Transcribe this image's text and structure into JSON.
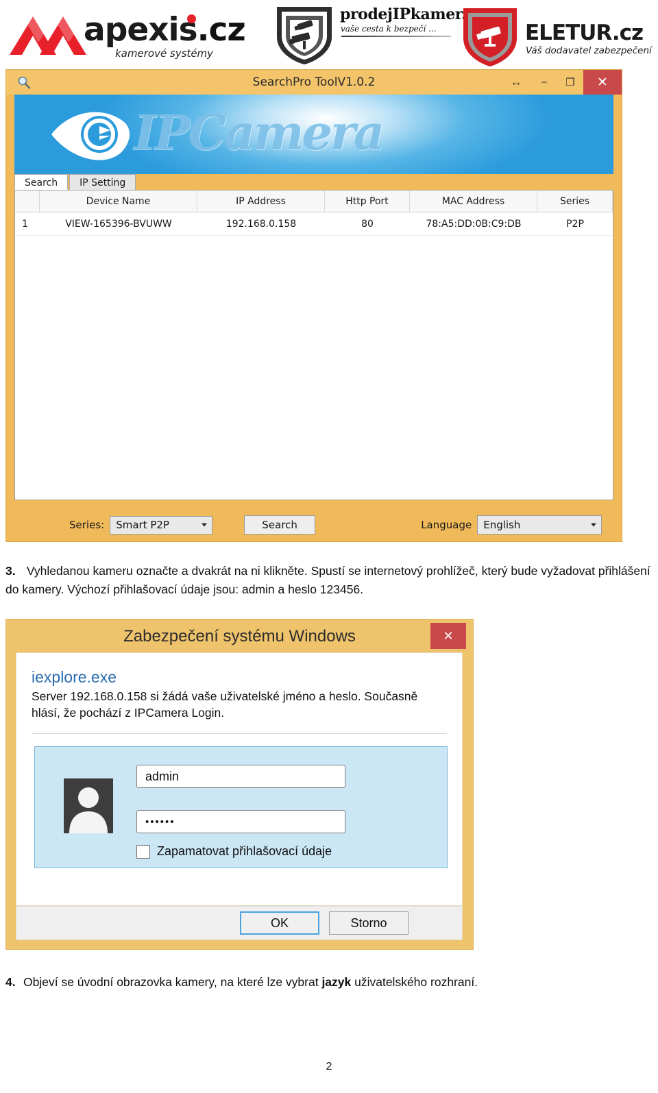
{
  "header": {
    "logos": [
      {
        "name": "apexis.cz",
        "brand": "apexis",
        "tld": ".cz",
        "tagline": "kamerové systémy",
        "color": "#e8202a"
      },
      {
        "name": "prodejIPkamer.cz",
        "title": "prodejIPkamer.cz",
        "tagline": "vaše cesta k bezpečí ...",
        "color": "#2b2b2b"
      },
      {
        "name": "ELETUR.cz",
        "title": "ELETUR.cz",
        "tagline": "Váš dodavatel zabezpečení",
        "color": "#d32027"
      }
    ]
  },
  "search_tool": {
    "title": "SearchPro ToolV1.0.2",
    "titlebar_accent": "#f3c46a",
    "close_color": "#c9484a",
    "window_buttons": {
      "resize": "↔",
      "minimize": "−",
      "maximize": "❐",
      "close": "✕"
    },
    "banner": {
      "word": "IPCamera",
      "accent": "#2b9bdc"
    },
    "tabs": [
      {
        "label": "Search",
        "active": true
      },
      {
        "label": "IP Setting",
        "active": false
      }
    ],
    "table": {
      "columns": [
        "",
        "Device Name",
        "IP Address",
        "Http Port",
        "MAC Address",
        "Series"
      ],
      "rows": [
        {
          "index": "1",
          "device_name": "VIEW-165396-BVUWW",
          "ip_address": "192.168.0.158",
          "http_port": "80",
          "mac_address": "78:A5:DD:0B:C9:DB",
          "series": "P2P"
        }
      ]
    },
    "bottom_bar": {
      "series_label": "Series:",
      "series_value": "Smart P2P",
      "search_button": "Search",
      "language_label": "Language",
      "language_value": "English"
    }
  },
  "step3": {
    "number": "3.",
    "text_part1": "Vyhledanou kameru označte a dvakrát na ni klikněte. Spustí se internetový prohlížeč, který bude vyžadovat přihlášení do kamery. Výchozí přihlašovací údaje jsou: admin a heslo 123456."
  },
  "security_dialog": {
    "title": "Zabezpečení systému Windows",
    "close_label": "✕",
    "app_name": "iexplore.exe",
    "message": "Server 192.168.0.158 si žádá vaše uživatelské jméno a heslo. Současně hlásí, že pochází z IPCamera Login.",
    "username_value": "admin",
    "password_value": "••••••",
    "remember_label": "Zapamatovat přihlašovací údaje",
    "ok_button": "OK",
    "cancel_button": "Storno",
    "accent": "#efc36c",
    "field_box_color": "#cbe6f5"
  },
  "step4": {
    "number": "4.",
    "text_before": "Objeví se úvodní obrazovka kamery, na které lze vybrat ",
    "bold_word": "jazyk",
    "text_after": " uživatelského rozhraní."
  },
  "footer": {
    "page_number": "2"
  }
}
